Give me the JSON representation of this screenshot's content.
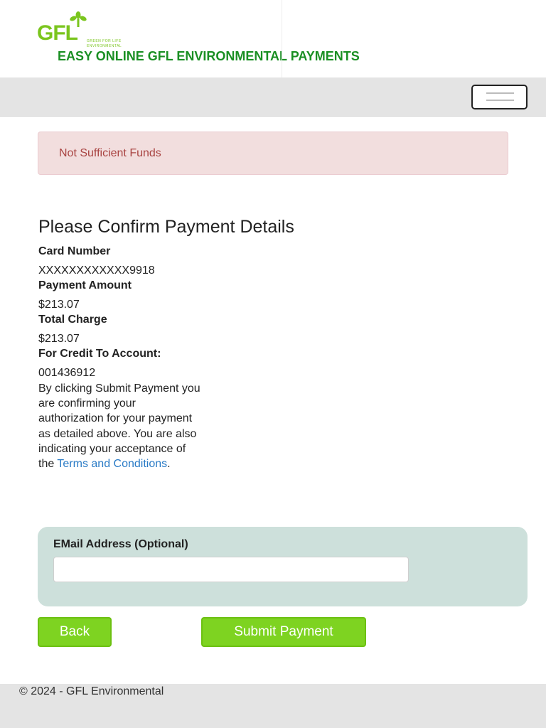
{
  "header": {
    "logo_text": "GFL",
    "logo_tagline": "green for life",
    "logo_sub": "environmental",
    "title": "EASY ONLINE GFL ENVIRONMENTAL PAYMENTS"
  },
  "alert": {
    "message": "Not Sufficient Funds"
  },
  "confirm": {
    "heading": "Please Confirm Payment Details",
    "card_number_label": "Card Number",
    "card_number_value": "XXXXXXXXXXXX9918",
    "payment_amount_label": "Payment Amount",
    "payment_amount_value": "$213.07",
    "total_charge_label": "Total Charge",
    "total_charge_value": "$213.07",
    "account_label": "For Credit To Account:",
    "account_value": "001436912",
    "disclaimer_text": "By clicking Submit Payment you are confirming your authorization for your payment as detailed above. You are also indicating your acceptance of the",
    "terms_link": "Terms and Conditions",
    "disclaimer_end": "."
  },
  "email": {
    "label": "EMail Address (Optional)",
    "value": "",
    "placeholder": ""
  },
  "buttons": {
    "back": "Back",
    "submit": "Submit Payment"
  },
  "footer": {
    "text": "© 2024 - GFL Environmental"
  },
  "colors": {
    "brand_green": "#7ac51d",
    "title_green": "#1a8f23",
    "button_green": "#7ed321",
    "alert_bg": "#f2dede",
    "alert_text": "#a94442",
    "link_blue": "#2a7bc6",
    "panel_bg": "#cde0db"
  }
}
